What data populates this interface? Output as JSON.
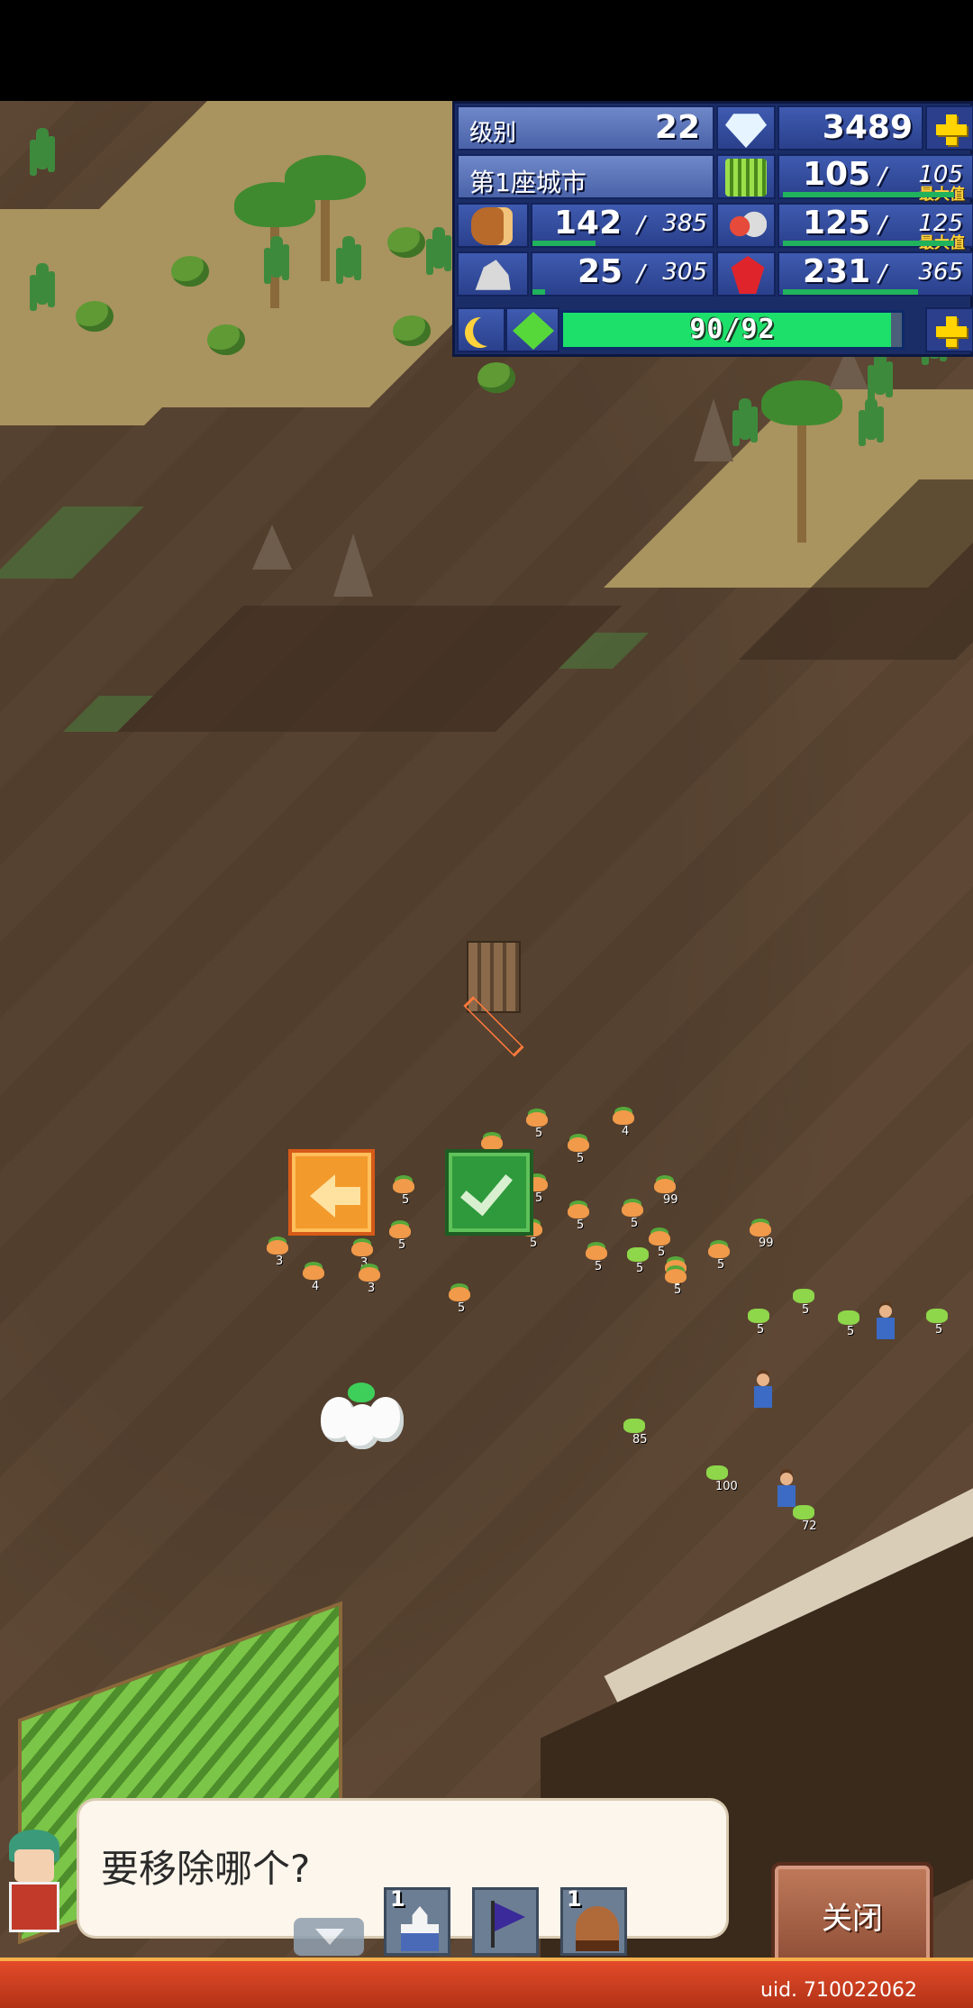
{
  "hud": {
    "rank_label": "级别",
    "rank_value": "22",
    "gems": "3489",
    "city_name": "第1座城市",
    "resources": [
      {
        "name": "grass",
        "icon": "grass-icon",
        "value": "105",
        "max": "105",
        "is_max": true,
        "max_label": "最大值"
      },
      {
        "name": "wood",
        "icon": "wood-icon",
        "value": "142",
        "max": "385",
        "is_max": false
      },
      {
        "name": "food",
        "icon": "food-icon",
        "value": "125",
        "max": "125",
        "is_max": true,
        "max_label": "最大值"
      },
      {
        "name": "ore",
        "icon": "ore-icon",
        "value": "25",
        "max": "305",
        "is_max": false
      },
      {
        "name": "ruby",
        "icon": "ruby-icon",
        "value": "231",
        "max": "365",
        "is_max": false
      }
    ],
    "energy": {
      "current": "90",
      "max": "92",
      "text": "90/92",
      "fraction": 0.978
    }
  },
  "field": {
    "crops": [
      {
        "count": "5"
      },
      {
        "count": "4"
      },
      {
        "count": "5"
      },
      {
        "count": "5"
      },
      {
        "count": "5"
      },
      {
        "count": "5"
      },
      {
        "count": "99"
      },
      {
        "count": "5"
      },
      {
        "count": "5"
      },
      {
        "count": "3"
      },
      {
        "count": "5"
      },
      {
        "count": "3"
      },
      {
        "count": "5"
      },
      {
        "count": "99"
      },
      {
        "count": "5"
      },
      {
        "count": "4"
      },
      {
        "count": "3"
      },
      {
        "count": "5"
      },
      {
        "count": "5"
      },
      {
        "count": "3"
      },
      {
        "count": "5"
      },
      {
        "count": "5"
      }
    ],
    "seedlings": [
      {
        "count": "5"
      },
      {
        "count": "5"
      },
      {
        "count": "5"
      },
      {
        "count": "5"
      },
      {
        "count": "5"
      },
      {
        "count": "85"
      },
      {
        "count": "100"
      },
      {
        "count": "72"
      }
    ],
    "tower_level": "1"
  },
  "dialog": {
    "prompt": "要移除哪个?",
    "close_label": "关闭",
    "slots": [
      {
        "count": "1",
        "icon": "castle-icon"
      },
      {
        "count": "",
        "icon": "flag-icon"
      },
      {
        "count": "1",
        "icon": "cave-icon"
      }
    ]
  },
  "footer": {
    "uid": "uid. 710022062"
  }
}
